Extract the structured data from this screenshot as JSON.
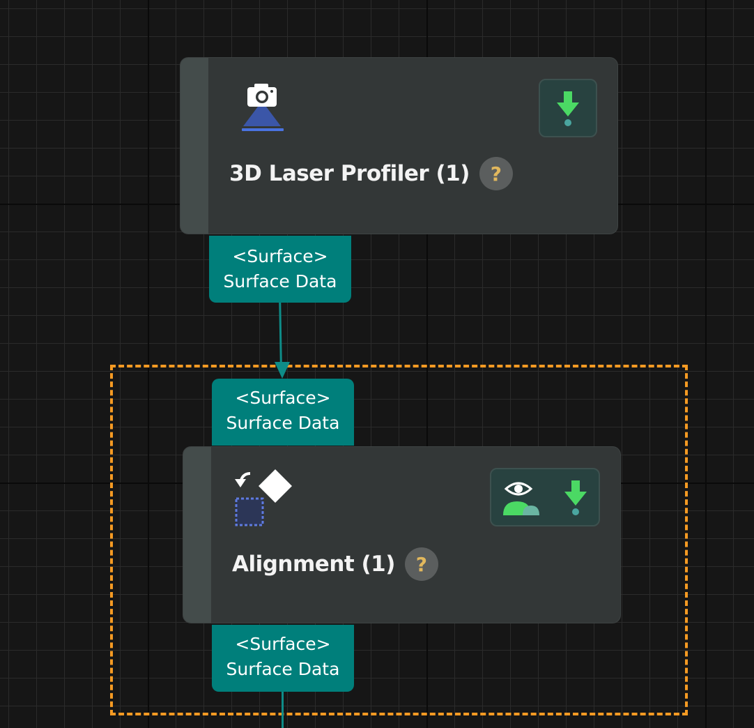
{
  "canvas": {
    "background": "#161616",
    "selection_color": "#f59a23"
  },
  "nodes": [
    {
      "title": "3D Laser Profiler (1)",
      "icon": "camera-laser-icon",
      "help_label": "?",
      "status_icons": [
        "download-icon"
      ]
    },
    {
      "title": "Alignment (1)",
      "icon": "alignment-icon",
      "help_label": "?",
      "status_icons": [
        "visualize-icon",
        "download-icon"
      ]
    }
  ],
  "ports": {
    "profiler_output": {
      "type": "<Surface>",
      "name": "Surface Data"
    },
    "alignment_input": {
      "type": "<Surface>",
      "name": "Surface Data"
    },
    "alignment_output": {
      "type": "<Surface>",
      "name": "Surface Data"
    }
  },
  "colors": {
    "node_bg": "#333737",
    "port_bg": "#007f7b",
    "status_green": "#4bd964",
    "help_icon_text": "#e2b85d"
  }
}
